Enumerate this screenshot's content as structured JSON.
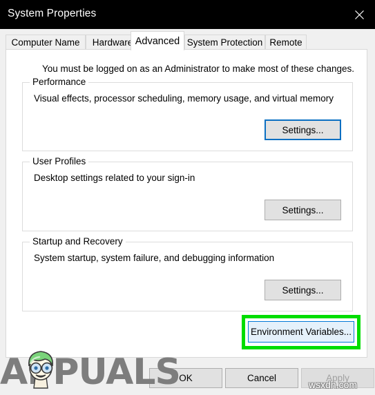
{
  "window": {
    "title": "System Properties",
    "close_icon": "close-icon"
  },
  "tabs": [
    {
      "label": "Computer Name",
      "active": false
    },
    {
      "label": "Hardware",
      "active": false
    },
    {
      "label": "Advanced",
      "active": true
    },
    {
      "label": "System Protection",
      "active": false
    },
    {
      "label": "Remote",
      "active": false
    }
  ],
  "advanced_tab": {
    "admin_note": "You must be logged on as an Administrator to make most of these changes.",
    "groups": [
      {
        "legend": "Performance",
        "description": "Visual effects, processor scheduling, memory usage, and virtual memory",
        "button_label": "Settings...",
        "button_state": "focused"
      },
      {
        "legend": "User Profiles",
        "description": "Desktop settings related to your sign-in",
        "button_label": "Settings...",
        "button_state": "normal"
      },
      {
        "legend": "Startup and Recovery",
        "description": "System startup, system failure, and debugging information",
        "button_label": "Settings...",
        "button_state": "normal"
      }
    ],
    "environment_variables_button": {
      "label": "Environment Variables...",
      "state": "hovered",
      "highlight_color": "#00dd00"
    }
  },
  "dialog_buttons": {
    "ok": "OK",
    "cancel": "Cancel",
    "apply": "Apply",
    "apply_state": "disabled"
  },
  "watermarks": {
    "appuals": "APPUALS",
    "site": "wsxdn.com"
  },
  "colors": {
    "titlebar_bg": "#000000",
    "titlebar_text": "#ffffff",
    "window_bg": "#f0f0f0",
    "panel_bg": "#ffffff",
    "focus_blue": "#0a6fc2",
    "hover_blue": "#0078d7",
    "hover_fill": "#e5f1fb",
    "annotation_green": "#00dd00",
    "button_face": "#e1e1e1",
    "disabled_text": "#a0a0a0"
  }
}
